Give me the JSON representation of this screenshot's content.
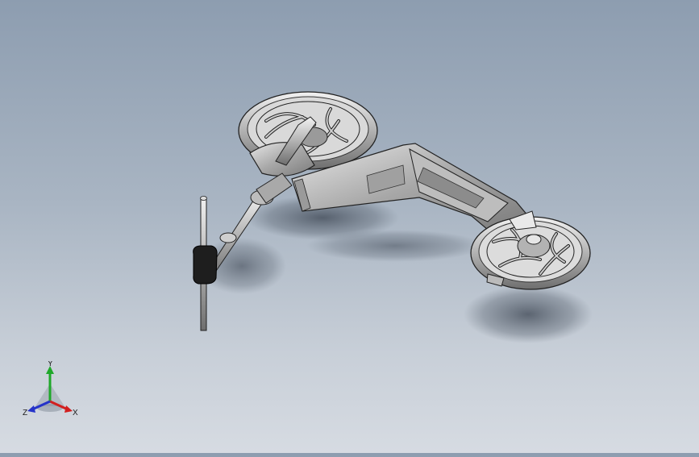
{
  "viewport": {
    "model": "scooter-assembly",
    "background_top": "#8d9db0",
    "background_bottom": "#d6dbe2"
  },
  "triad": {
    "x_label": "X",
    "y_label": "Y",
    "z_label": "Z",
    "x_color": "#d21f1f",
    "y_color": "#1fa82a",
    "z_color": "#2533c9"
  }
}
